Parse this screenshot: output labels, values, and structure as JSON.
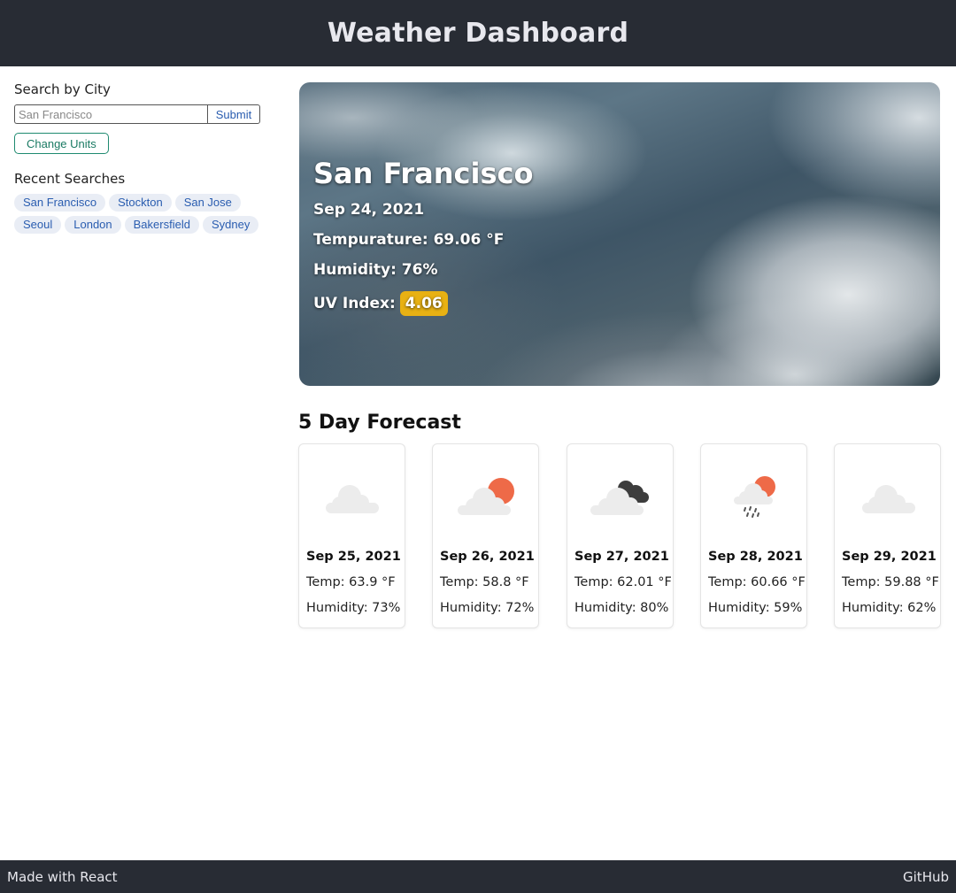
{
  "header": {
    "title": "Weather Dashboard"
  },
  "sidebar": {
    "search_label": "Search by City",
    "search_placeholder": "San Francisco",
    "submit_label": "Submit",
    "change_units_label": "Change Units",
    "recent_title": "Recent Searches",
    "recent": [
      "San Francisco",
      "Stockton",
      "San Jose",
      "Seoul",
      "London",
      "Bakersfield",
      "Sydney"
    ]
  },
  "current": {
    "city": "San Francisco",
    "date": "Sep 24, 2021",
    "temperature": "Tempurature: 69.06 °F",
    "humidity": "Humidity: 76%",
    "uv_label": "UV Index:",
    "uv_value": "4.06",
    "uv_color": "#e8b113"
  },
  "forecast": {
    "title": "5 Day Forecast",
    "days": [
      {
        "date": "Sep 25, 2021",
        "temp": "Temp: 63.9 °F",
        "humidity": "Humidity: 73%",
        "icon": "cloud-icon"
      },
      {
        "date": "Sep 26, 2021",
        "temp": "Temp: 58.8 °F",
        "humidity": "Humidity: 72%",
        "icon": "partly-cloudy-icon"
      },
      {
        "date": "Sep 27, 2021",
        "temp": "Temp: 62.01 °F",
        "humidity": "Humidity: 80%",
        "icon": "dark-clouds-icon"
      },
      {
        "date": "Sep 28, 2021",
        "temp": "Temp: 60.66 °F",
        "humidity": "Humidity: 59%",
        "icon": "sun-rain-icon"
      },
      {
        "date": "Sep 29, 2021",
        "temp": "Temp: 59.88 °F",
        "humidity": "Humidity: 62%",
        "icon": "cloud-icon"
      }
    ]
  },
  "footer": {
    "left": "Made with React",
    "right": "GitHub"
  }
}
